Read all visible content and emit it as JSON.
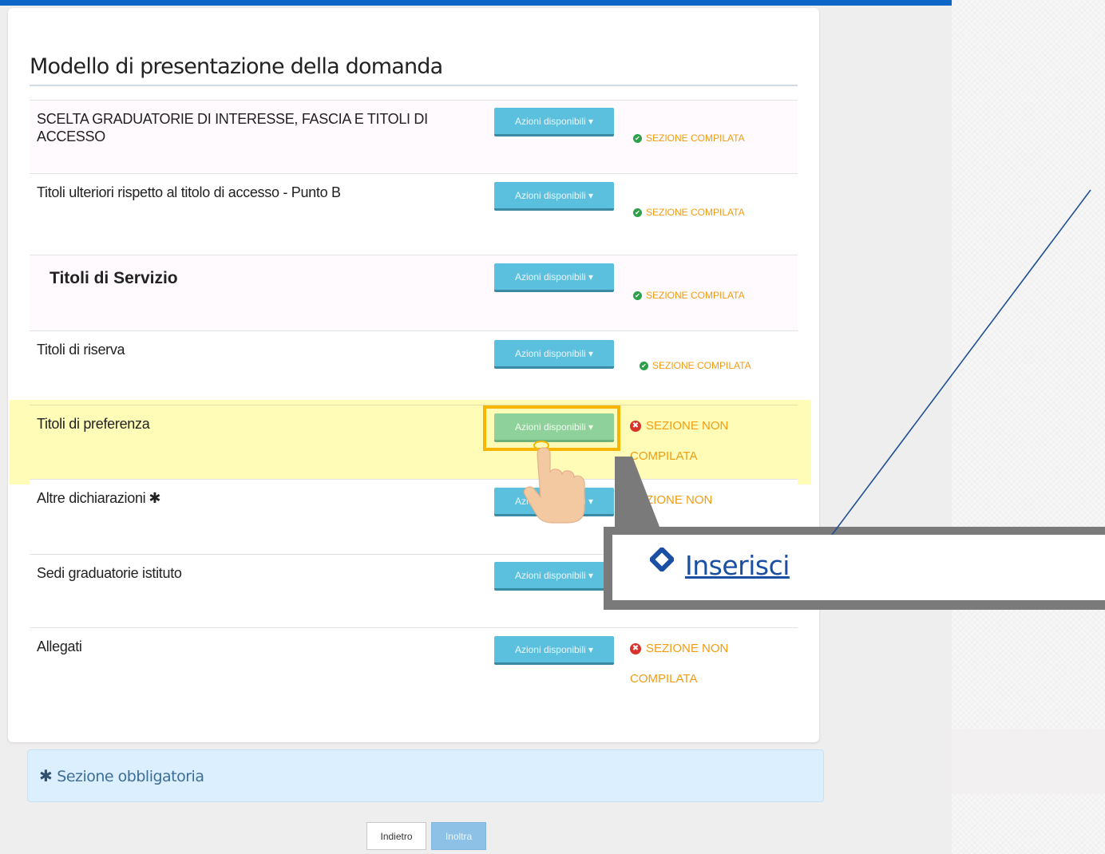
{
  "page": {
    "title": "Modello di presentazione della domanda",
    "required_note": "Sezione obbligatoria",
    "required_symbol": "✱"
  },
  "action_button_label": "Azioni disponibili",
  "status": {
    "complete": "SEZIONE COMPILATA",
    "incomplete": "SEZIONE NON COMPILATA",
    "incomplete_partial": "SEZIONE NON"
  },
  "rows": [
    {
      "label": "SCELTA GRADUATORIE DI INTERESSE, FASCIA E TITOLI DI ACCESSO",
      "state": "complete"
    },
    {
      "label": "Titoli ulteriori rispetto al titolo di accesso - Punto B",
      "state": "complete"
    },
    {
      "label": "Titoli di Servizio",
      "state": "complete"
    },
    {
      "label": "Titoli di riserva",
      "state": "complete"
    },
    {
      "label": "Titoli di preferenza",
      "state": "incomplete"
    },
    {
      "label": "Altre dichiarazioni",
      "state": "incomplete",
      "required": true
    },
    {
      "label": "Sedi graduatorie istituto",
      "state": "incomplete"
    },
    {
      "label": "Allegati",
      "state": "incomplete"
    }
  ],
  "callout": {
    "label": "Inserisci"
  },
  "footer": {
    "back_label": "Indietro",
    "submit_label": "Inoltra"
  },
  "colors": {
    "accent": "#5bc0de",
    "highlight": "#fffa8c",
    "warning": "#f39c12",
    "ok": "#2e9f4a",
    "error": "#d9322a",
    "link": "#1a4fa3"
  }
}
